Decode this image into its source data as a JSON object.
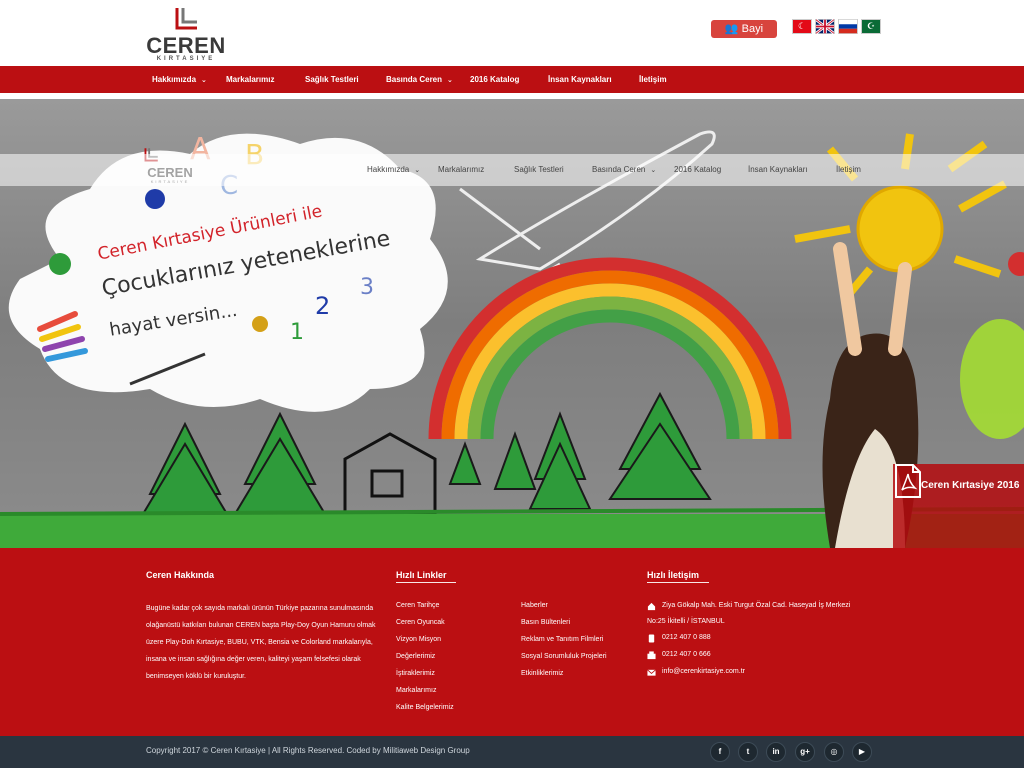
{
  "brand": {
    "name": "CEREN",
    "tagline": "KIRTASIYE",
    "red": "#bb0f12",
    "dark": "#2a3540"
  },
  "header": {
    "dealer_login": "Bayi Girişi",
    "languages": [
      "tr-flag-icon",
      "en-flag-icon",
      "ru-flag-icon",
      "ar-flag-icon"
    ]
  },
  "nav": {
    "items": [
      {
        "label": "Hakkımızda",
        "dropdown": true
      },
      {
        "label": "Markalarımız",
        "dropdown": false
      },
      {
        "label": "Sağlık Testleri",
        "dropdown": false
      },
      {
        "label": "Basında Ceren",
        "dropdown": true
      },
      {
        "label": "2016 Katalog",
        "dropdown": false
      },
      {
        "label": "İnsan Kaynakları",
        "dropdown": false
      },
      {
        "label": "İletişim",
        "dropdown": false
      }
    ]
  },
  "hero": {
    "line1": "Ceren Kırtasiye Ürünleri ile",
    "line2": "Çocuklarınız yeteneklerine",
    "line3": "hayat versin...",
    "catalog_title": "Ceren Kırtasiye 2016"
  },
  "footer": {
    "about": {
      "title": "Ceren Hakkında",
      "text": "Bugüne kadar çok sayıda markalı ürünün Türkiye pazarına sunulmasında olağanüstü katkıları bulunan CEREN başta Play-Doy Oyun Hamuru olmak üzere Play-Doh Kırtasiye, BUBU, VTK, Bensia ve Colorland markalarıyla, insana ve insan sağlığına değer veren, kaliteyi yaşam felsefesi olarak benimseyen köklü bir kuruluştur."
    },
    "links": {
      "title": "Hızlı Linkler",
      "col1": [
        "Ceren Tarihçe",
        "Ceren Oyuncak",
        "Vizyon Misyon",
        "Değerlerimiz",
        "İştiraklerimiz",
        "Markalarımız",
        "Kalite Belgelerimiz"
      ],
      "col2": [
        "Haberler",
        "Basın Bültenleri",
        "Reklam ve Tanıtım Filmleri",
        "Sosyal Sorumluluk Projeleri",
        "Etkinliklerimiz"
      ]
    },
    "contact": {
      "title": "Hızlı İletişim",
      "address_line1": "Ziya Gökalp Mah. Eski Turgut Özal Cad. Haseyad İş Merkezi",
      "address_line2": "No:25 İkitelli / İSTANBUL",
      "phone": "0212 407 0 888",
      "fax": "0212 407 0 666",
      "email": "info@cerenkirtasiye.com.tr"
    }
  },
  "bottom": {
    "copyright": "Copyright 2017 © Ceren Kırtasiye | All Rights Reserved. Coded by Militiaweb Design Group",
    "social": [
      {
        "icon": "facebook-icon",
        "glyph": "f"
      },
      {
        "icon": "twitter-icon",
        "glyph": "t"
      },
      {
        "icon": "linkedin-icon",
        "glyph": "in"
      },
      {
        "icon": "google-plus-icon",
        "glyph": "g+"
      },
      {
        "icon": "instagram-icon",
        "glyph": "◎"
      },
      {
        "icon": "youtube-icon",
        "glyph": "▶"
      }
    ]
  }
}
